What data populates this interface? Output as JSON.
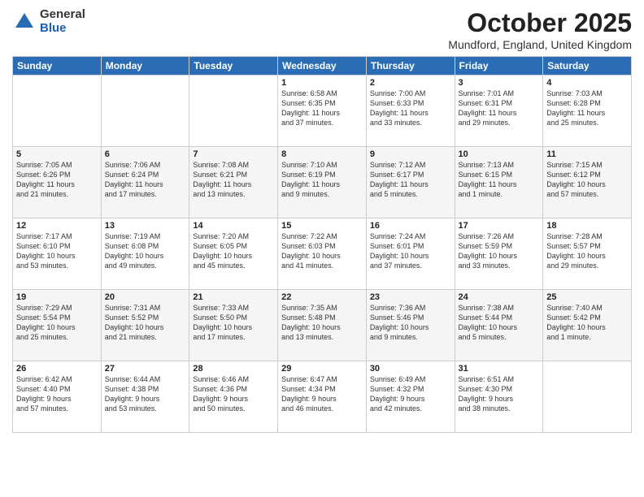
{
  "header": {
    "logo_general": "General",
    "logo_blue": "Blue",
    "month": "October 2025",
    "location": "Mundford, England, United Kingdom"
  },
  "days_of_week": [
    "Sunday",
    "Monday",
    "Tuesday",
    "Wednesday",
    "Thursday",
    "Friday",
    "Saturday"
  ],
  "weeks": [
    [
      {
        "day": "",
        "info": ""
      },
      {
        "day": "",
        "info": ""
      },
      {
        "day": "",
        "info": ""
      },
      {
        "day": "1",
        "info": "Sunrise: 6:58 AM\nSunset: 6:35 PM\nDaylight: 11 hours\nand 37 minutes."
      },
      {
        "day": "2",
        "info": "Sunrise: 7:00 AM\nSunset: 6:33 PM\nDaylight: 11 hours\nand 33 minutes."
      },
      {
        "day": "3",
        "info": "Sunrise: 7:01 AM\nSunset: 6:31 PM\nDaylight: 11 hours\nand 29 minutes."
      },
      {
        "day": "4",
        "info": "Sunrise: 7:03 AM\nSunset: 6:28 PM\nDaylight: 11 hours\nand 25 minutes."
      }
    ],
    [
      {
        "day": "5",
        "info": "Sunrise: 7:05 AM\nSunset: 6:26 PM\nDaylight: 11 hours\nand 21 minutes."
      },
      {
        "day": "6",
        "info": "Sunrise: 7:06 AM\nSunset: 6:24 PM\nDaylight: 11 hours\nand 17 minutes."
      },
      {
        "day": "7",
        "info": "Sunrise: 7:08 AM\nSunset: 6:21 PM\nDaylight: 11 hours\nand 13 minutes."
      },
      {
        "day": "8",
        "info": "Sunrise: 7:10 AM\nSunset: 6:19 PM\nDaylight: 11 hours\nand 9 minutes."
      },
      {
        "day": "9",
        "info": "Sunrise: 7:12 AM\nSunset: 6:17 PM\nDaylight: 11 hours\nand 5 minutes."
      },
      {
        "day": "10",
        "info": "Sunrise: 7:13 AM\nSunset: 6:15 PM\nDaylight: 11 hours\nand 1 minute."
      },
      {
        "day": "11",
        "info": "Sunrise: 7:15 AM\nSunset: 6:12 PM\nDaylight: 10 hours\nand 57 minutes."
      }
    ],
    [
      {
        "day": "12",
        "info": "Sunrise: 7:17 AM\nSunset: 6:10 PM\nDaylight: 10 hours\nand 53 minutes."
      },
      {
        "day": "13",
        "info": "Sunrise: 7:19 AM\nSunset: 6:08 PM\nDaylight: 10 hours\nand 49 minutes."
      },
      {
        "day": "14",
        "info": "Sunrise: 7:20 AM\nSunset: 6:05 PM\nDaylight: 10 hours\nand 45 minutes."
      },
      {
        "day": "15",
        "info": "Sunrise: 7:22 AM\nSunset: 6:03 PM\nDaylight: 10 hours\nand 41 minutes."
      },
      {
        "day": "16",
        "info": "Sunrise: 7:24 AM\nSunset: 6:01 PM\nDaylight: 10 hours\nand 37 minutes."
      },
      {
        "day": "17",
        "info": "Sunrise: 7:26 AM\nSunset: 5:59 PM\nDaylight: 10 hours\nand 33 minutes."
      },
      {
        "day": "18",
        "info": "Sunrise: 7:28 AM\nSunset: 5:57 PM\nDaylight: 10 hours\nand 29 minutes."
      }
    ],
    [
      {
        "day": "19",
        "info": "Sunrise: 7:29 AM\nSunset: 5:54 PM\nDaylight: 10 hours\nand 25 minutes."
      },
      {
        "day": "20",
        "info": "Sunrise: 7:31 AM\nSunset: 5:52 PM\nDaylight: 10 hours\nand 21 minutes."
      },
      {
        "day": "21",
        "info": "Sunrise: 7:33 AM\nSunset: 5:50 PM\nDaylight: 10 hours\nand 17 minutes."
      },
      {
        "day": "22",
        "info": "Sunrise: 7:35 AM\nSunset: 5:48 PM\nDaylight: 10 hours\nand 13 minutes."
      },
      {
        "day": "23",
        "info": "Sunrise: 7:36 AM\nSunset: 5:46 PM\nDaylight: 10 hours\nand 9 minutes."
      },
      {
        "day": "24",
        "info": "Sunrise: 7:38 AM\nSunset: 5:44 PM\nDaylight: 10 hours\nand 5 minutes."
      },
      {
        "day": "25",
        "info": "Sunrise: 7:40 AM\nSunset: 5:42 PM\nDaylight: 10 hours\nand 1 minute."
      }
    ],
    [
      {
        "day": "26",
        "info": "Sunrise: 6:42 AM\nSunset: 4:40 PM\nDaylight: 9 hours\nand 57 minutes."
      },
      {
        "day": "27",
        "info": "Sunrise: 6:44 AM\nSunset: 4:38 PM\nDaylight: 9 hours\nand 53 minutes."
      },
      {
        "day": "28",
        "info": "Sunrise: 6:46 AM\nSunset: 4:36 PM\nDaylight: 9 hours\nand 50 minutes."
      },
      {
        "day": "29",
        "info": "Sunrise: 6:47 AM\nSunset: 4:34 PM\nDaylight: 9 hours\nand 46 minutes."
      },
      {
        "day": "30",
        "info": "Sunrise: 6:49 AM\nSunset: 4:32 PM\nDaylight: 9 hours\nand 42 minutes."
      },
      {
        "day": "31",
        "info": "Sunrise: 6:51 AM\nSunset: 4:30 PM\nDaylight: 9 hours\nand 38 minutes."
      },
      {
        "day": "",
        "info": ""
      }
    ]
  ]
}
